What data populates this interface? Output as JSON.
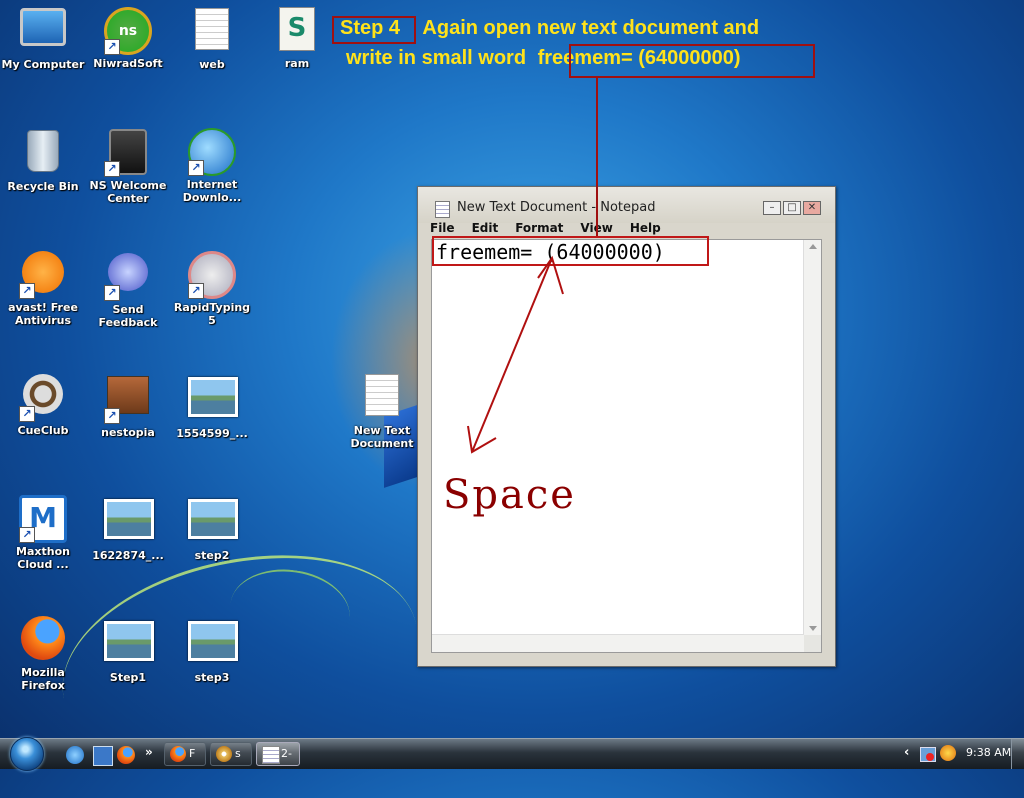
{
  "desktop": {
    "icons": [
      {
        "label": "My Computer"
      },
      {
        "label": "NiwradSoft"
      },
      {
        "label": "web"
      },
      {
        "label": "ram"
      },
      {
        "label": "Recycle Bin"
      },
      {
        "label": "NS Welcome Center"
      },
      {
        "label": "Internet Downlo..."
      },
      {
        "label": "avast! Free Antivirus"
      },
      {
        "label": "Send Feedback"
      },
      {
        "label": "RapidTyping 5"
      },
      {
        "label": "CueClub"
      },
      {
        "label": "nestopia"
      },
      {
        "label": "1554599_..."
      },
      {
        "label": "New Text Document"
      },
      {
        "label": "Maxthon Cloud ..."
      },
      {
        "label": "1622874_..."
      },
      {
        "label": "step2"
      },
      {
        "label": "Mozilla Firefox"
      },
      {
        "label": "Step1"
      },
      {
        "label": "step3"
      }
    ]
  },
  "annotation": {
    "step_label": "Step 4",
    "line1_rest": "Again open new text document and",
    "line2_prefix": "write in small word ",
    "line2_code": "freemem= (64000000)",
    "handwritten": "Space"
  },
  "notepad": {
    "title": "New Text Document - Notepad",
    "menu": [
      "File",
      "Edit",
      "Format",
      "View",
      "Help"
    ],
    "content": "freemem= (64000000)",
    "buttons": {
      "minimize": "–",
      "maximize": "□",
      "close": "✕"
    }
  },
  "taskbar": {
    "overflow": "»",
    "tasks": [
      {
        "label": "F"
      },
      {
        "label": "s"
      },
      {
        "label": "2-"
      }
    ],
    "tray_arrow": "‹",
    "time": "9:38 AM"
  },
  "colors": {
    "annotation_text": "#ffe21a",
    "annotation_box": "#a01010",
    "handwriting": "#8a0000"
  }
}
